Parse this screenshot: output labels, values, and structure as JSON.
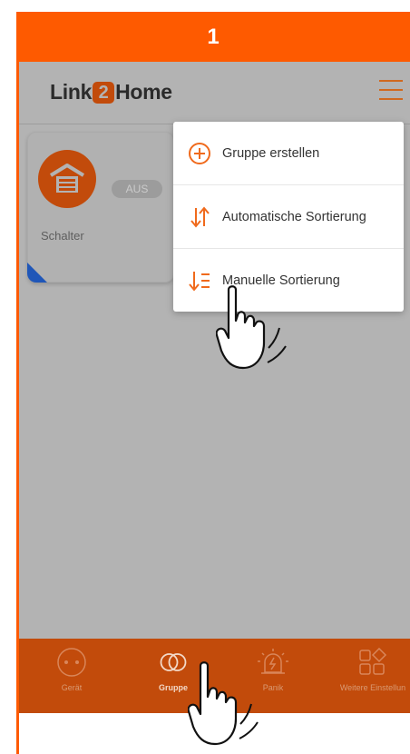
{
  "step": {
    "number": "1"
  },
  "header": {
    "logo": {
      "left": "Link",
      "middle": "2",
      "right": "Home"
    }
  },
  "device_card": {
    "name": "Schalter",
    "state": "AUS"
  },
  "dropdown_menu": {
    "items": [
      {
        "label": "Gruppe erstellen",
        "icon": "plus-circle-icon"
      },
      {
        "label": "Automatische Sortierung",
        "icon": "sort-arrows-icon"
      },
      {
        "label": "Manuelle Sortierung",
        "icon": "sort-list-icon"
      }
    ]
  },
  "bottom_nav": {
    "items": [
      {
        "label": "Gerät",
        "icon": "socket-icon"
      },
      {
        "label": "Gruppe",
        "icon": "rings-icon"
      },
      {
        "label": "Panik",
        "icon": "siren-icon"
      },
      {
        "label": "Weitere Einstellun",
        "icon": "grid-icon"
      }
    ],
    "active": "Gruppe"
  },
  "colors": {
    "accent": "#fe5a00",
    "brand_dark": "#c24b0b",
    "overlay_gray": "#b3b3b3",
    "badge_blue": "#1f56b8"
  }
}
